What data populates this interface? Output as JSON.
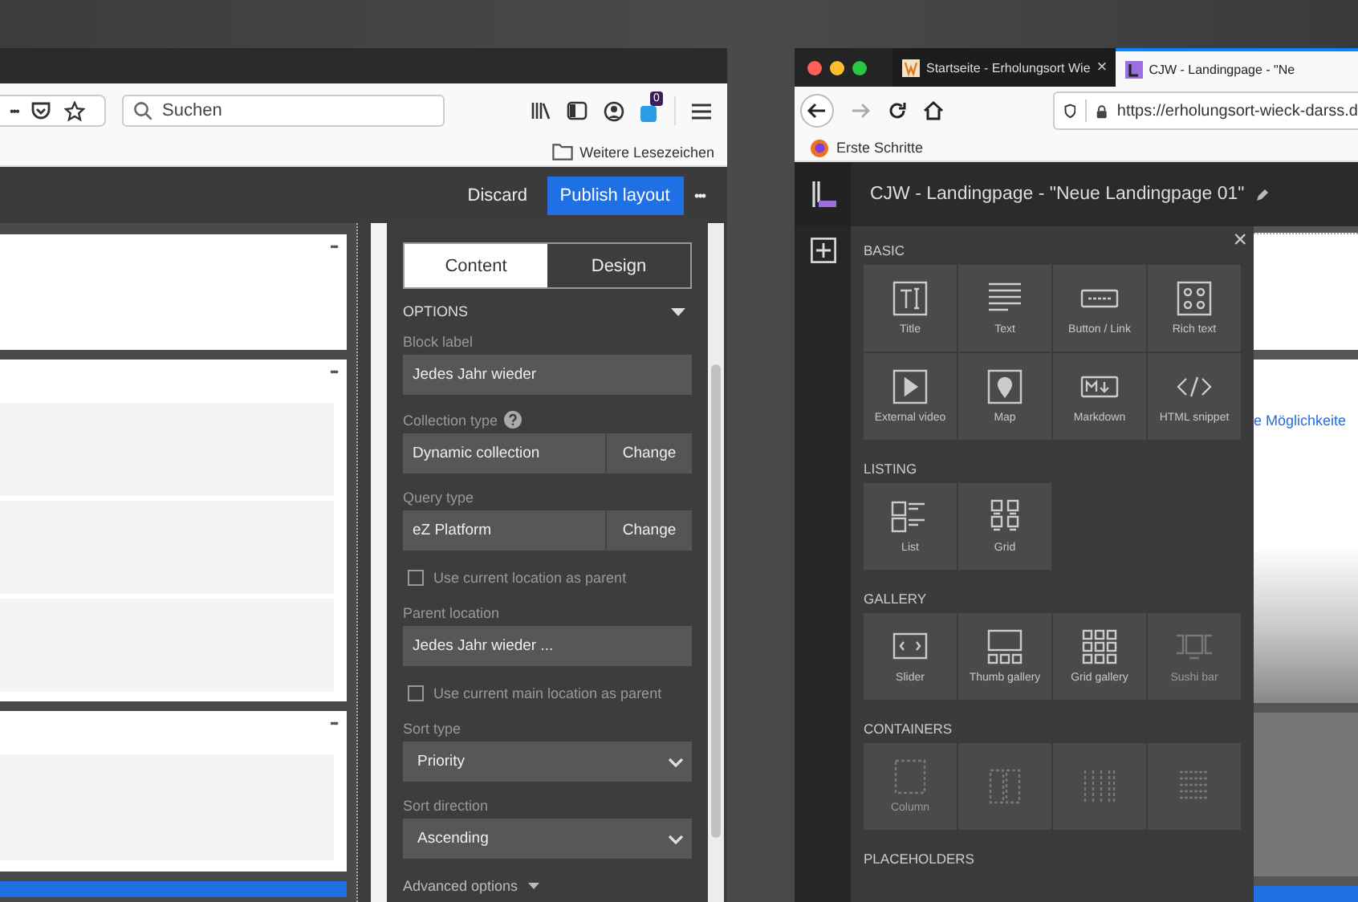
{
  "left_window": {
    "toolbar": {
      "more": "•••",
      "search_placeholder": "Suchen",
      "badge": "0"
    },
    "bookmarks": [
      "Weitere Lesezeichen"
    ],
    "header": {
      "discard": "Discard",
      "publish": "Publish layout",
      "more": "•••"
    },
    "blocks": [
      {
        "menu": "•••",
        "kind": "empty"
      },
      {
        "menu": "•••",
        "kind": "list3"
      },
      {
        "menu": "•••",
        "kind": "list1"
      }
    ],
    "sidebar": {
      "tabs": [
        {
          "label": "Content",
          "selected": true
        },
        {
          "label": "Design",
          "selected": false
        }
      ],
      "section": "OPTIONS",
      "fields": [
        {
          "kind": "text",
          "label": "Block label",
          "value": "Jedes Jahr wieder"
        },
        {
          "kind": "change",
          "label": "Collection type",
          "help": true,
          "value": "Dynamic collection",
          "action": "Change"
        },
        {
          "kind": "change",
          "label": "Query type",
          "help": false,
          "value": "eZ Platform",
          "action": "Change"
        },
        {
          "kind": "checkbox",
          "label": "Use current location as parent",
          "checked": false
        },
        {
          "kind": "text",
          "label": "Parent location",
          "value": "Jedes Jahr wieder ..."
        },
        {
          "kind": "checkbox",
          "label": "Use current main location as parent",
          "checked": false
        },
        {
          "kind": "select",
          "label": "Sort type",
          "value": "Priority"
        },
        {
          "kind": "select",
          "label": "Sort direction",
          "value": "Ascending"
        }
      ],
      "advanced": "Advanced options"
    }
  },
  "right_window": {
    "tabs": [
      {
        "label": "Startseite - Erholungsort Wie",
        "selected": false,
        "close": "×"
      },
      {
        "label": "CJW - Landingpage - \"Ne",
        "selected": true
      }
    ],
    "url": "https://erholungsort-wieck-darss.d",
    "bookmarks": [
      "Erste Schritte"
    ],
    "app_title": "CJW - Landingpage - \"Neue Landingpage 01\"",
    "library": [
      {
        "title": "BASIC",
        "items": [
          {
            "kind": "title",
            "label": "Title",
            "disabled": false
          },
          {
            "kind": "text",
            "label": "Text",
            "disabled": false
          },
          {
            "kind": "button",
            "label": "Button / Link",
            "disabled": false
          },
          {
            "kind": "richtext",
            "label": "Rich text",
            "disabled": false
          },
          {
            "kind": "video",
            "label": "External video",
            "disabled": false
          },
          {
            "kind": "map",
            "label": "Map",
            "disabled": false
          },
          {
            "kind": "markdown",
            "label": "Markdown",
            "disabled": false
          },
          {
            "kind": "html",
            "label": "HTML snippet",
            "disabled": false
          }
        ]
      },
      {
        "title": "LISTING",
        "items": [
          {
            "kind": "list",
            "label": "List",
            "disabled": false
          },
          {
            "kind": "grid",
            "label": "Grid",
            "disabled": false
          }
        ]
      },
      {
        "title": "GALLERY",
        "items": [
          {
            "kind": "slider",
            "label": "Slider",
            "disabled": false
          },
          {
            "kind": "thumb",
            "label": "Thumb gallery",
            "disabled": false
          },
          {
            "kind": "gridgallery",
            "label": "Grid gallery",
            "disabled": false
          },
          {
            "kind": "sushi",
            "label": "Sushi bar",
            "disabled": true
          }
        ]
      },
      {
        "title": "CONTAINERS",
        "items": [
          {
            "kind": "column",
            "label": "Column",
            "disabled": true
          },
          {
            "kind": "column2",
            "disabled": true
          },
          {
            "kind": "column3",
            "disabled": true
          },
          {
            "kind": "column4",
            "disabled": true
          }
        ]
      },
      {
        "title": "PLACEHOLDERS"
      }
    ],
    "library_close": "×",
    "preview_link": "e Möglichkeite"
  }
}
